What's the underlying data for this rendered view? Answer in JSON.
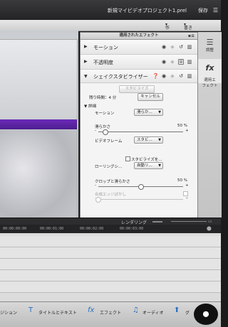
{
  "window": {
    "title": "新規マイビデオプロジェクト1.prel",
    "save_label": "保存",
    "menu_icon": "menu-icon"
  },
  "menubar": {
    "create": "作成",
    "export": "書き出し・配信"
  },
  "panel": {
    "header": "適用されたエフェクト",
    "effects": [
      {
        "name": "モーション"
      },
      {
        "name": "不透明度"
      },
      {
        "name": "シェイクスタビライザー"
      }
    ],
    "stabilize_button": "スタビライズ",
    "remaining_label": "残り時間：4 分",
    "cancel_button": "キャンセル",
    "detail_label": "詳細",
    "motion_label": "モーション",
    "motion_value": "滑らか...",
    "smoothness_label": "滑らかさ",
    "smoothness_value": "50 %",
    "smoothness_level": 0.08,
    "video_frame_label": "ビデオフレーム",
    "video_frame_value": "スタビ...",
    "stabilize_check_label": "スタビライズを...",
    "rolling_label": "ローリングシ...",
    "rolling_value": "自動リ...",
    "crop_label": "クロップと滑らかさ",
    "crop_value": "50 %",
    "crop_level": 0.5,
    "composite_label": "合成エッジぼかし",
    "composite_level": 0.0,
    "minus": "-",
    "plus": "+"
  },
  "sidebar": {
    "adjust_label": "調整",
    "fx_label": "適用エ\nフェクト"
  },
  "timeline": {
    "render_label": "レンダリング",
    "timecodes": [
      "00:00:00:00",
      "00:00:01:00",
      "00:00:02:00",
      "00:00:03:00"
    ]
  },
  "bottombar": {
    "items": [
      "ジション",
      "タイトルとテキスト",
      "エフェクト",
      "オーディオ",
      "グ"
    ]
  }
}
